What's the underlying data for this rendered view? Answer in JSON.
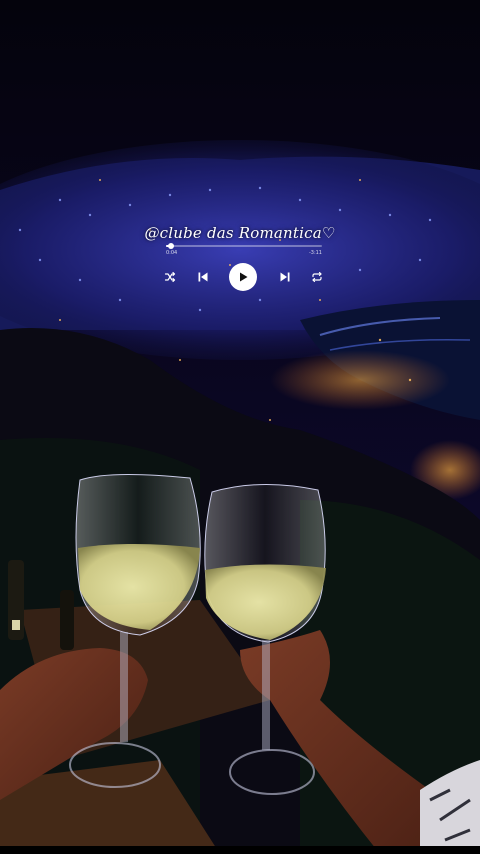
{
  "overlay": {
    "handle": "@clube das Romantica♡",
    "time_elapsed": "0:04",
    "time_remaining": "-3:11",
    "progress": 0.03
  },
  "controls": {
    "shuffle": "shuffle-icon",
    "previous": "skip-previous-icon",
    "play": "play-icon",
    "next": "skip-next-icon",
    "repeat": "repeat-icon"
  },
  "colors": {
    "sky": "#0a0724",
    "city_lights_blue": "#3a46d8",
    "city_lights_warm": "#f0a030",
    "sea": "#0a1030",
    "wine": "#e9e6a0"
  }
}
